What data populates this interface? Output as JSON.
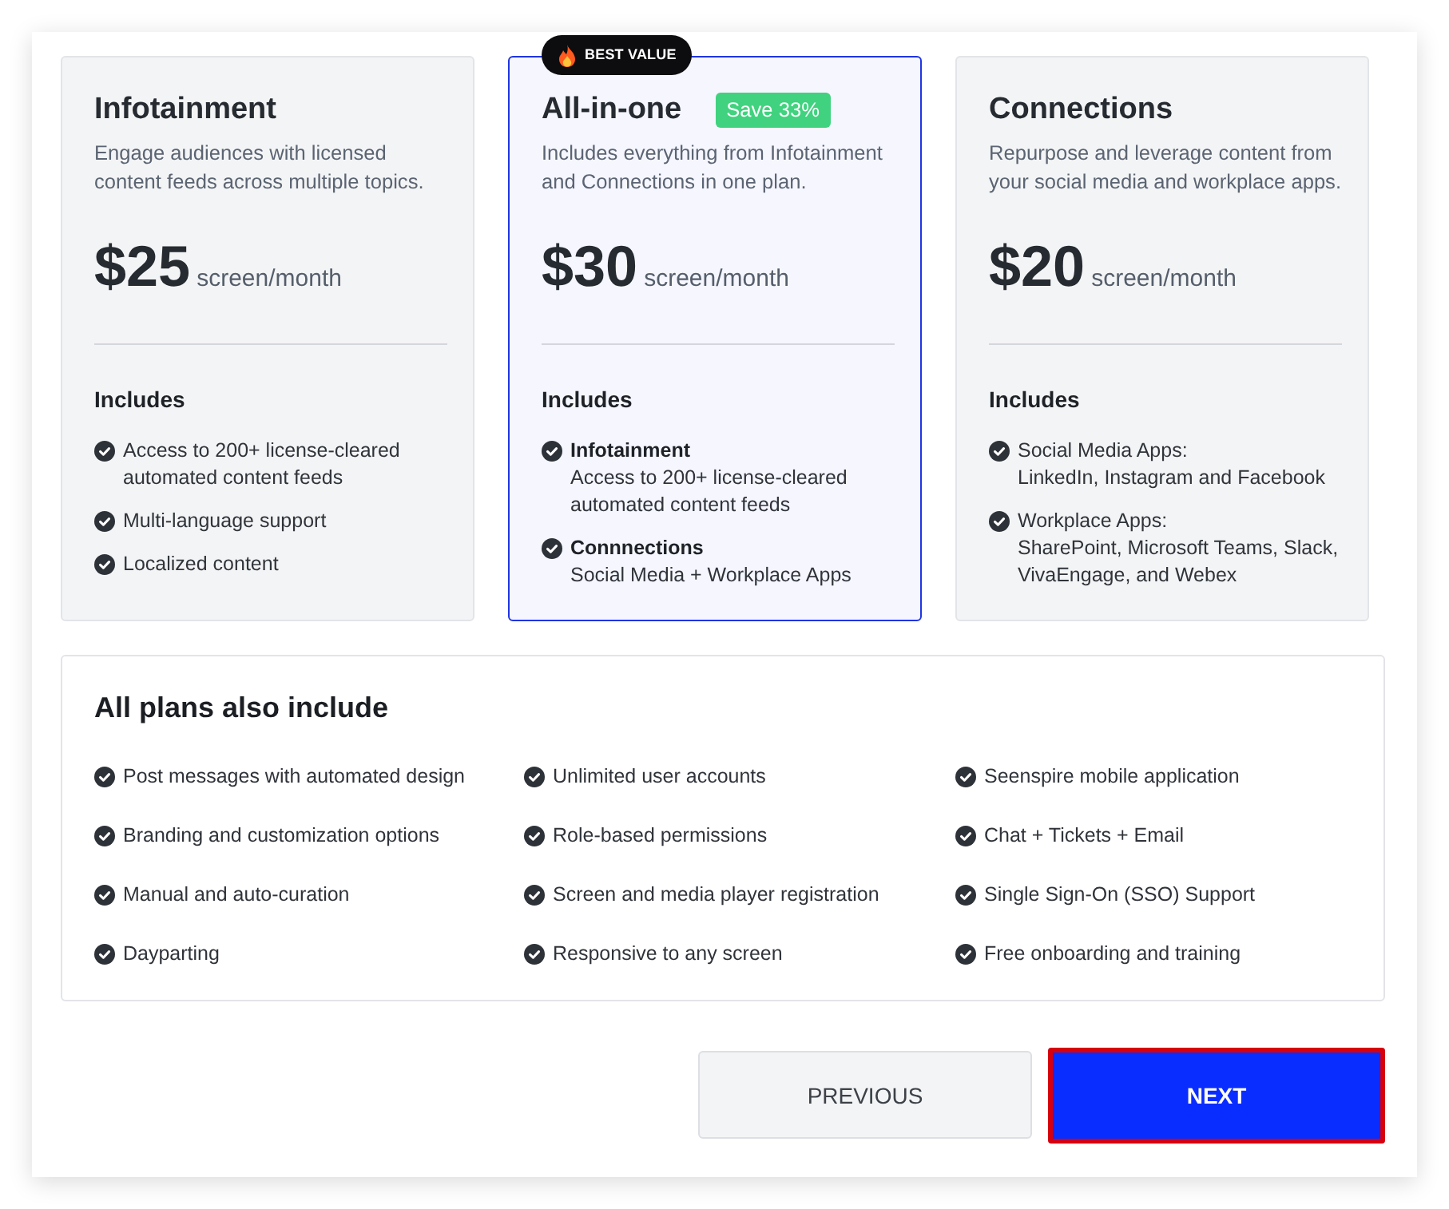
{
  "plans": [
    {
      "name": "Infotainment",
      "selected": false,
      "description": "Engage audiences with licensed content feeds across multiple topics.",
      "price": "$25",
      "unit": "screen/month",
      "includes_heading": "Includes",
      "features": [
        {
          "text": "Access to 200+ license-cleared automated content feeds"
        },
        {
          "text": "Multi-language support"
        },
        {
          "text": "Localized content"
        }
      ]
    },
    {
      "name": "All-in-one",
      "selected": true,
      "ribbon": "BEST VALUE",
      "tag": "Save 33%",
      "description": "Includes everything from Infotainment and Connections in one plan.",
      "price": "$30",
      "unit": "screen/month",
      "includes_heading": "Includes",
      "features": [
        {
          "title": "Infotainment",
          "bold": true,
          "text": "Access to 200+ license-cleared automated content feeds"
        },
        {
          "title": "Connnections",
          "bold": true,
          "text": "Social Media + Workplace Apps"
        }
      ]
    },
    {
      "name": "Connections",
      "selected": false,
      "description": "Repurpose and leverage content from your social media and workplace apps.",
      "price": "$20",
      "unit": "screen/month",
      "includes_heading": "Includes",
      "features": [
        {
          "title": "Social Media Apps:",
          "bold": false,
          "text": "LinkedIn, Instagram and Facebook"
        },
        {
          "title": "Workplace Apps:",
          "bold": false,
          "text": "SharePoint, Microsoft Teams, Slack, VivaEngage, and Webex"
        }
      ]
    }
  ],
  "all_plans": {
    "heading": "All plans also include",
    "columns": [
      [
        "Post messages with automated design",
        "Branding and customization options",
        "Manual and auto-curation",
        "Dayparting"
      ],
      [
        "Unlimited user accounts",
        "Role-based permissions",
        "Screen and media player registration",
        "Responsive to any screen"
      ],
      [
        "Seenspire mobile application",
        "Chat + Tickets + Email",
        "Single Sign-On (SSO) Support",
        "Free onboarding and training"
      ]
    ]
  },
  "buttons": [
    {
      "label": "PREVIOUS",
      "kind": "secondary",
      "focused": false
    },
    {
      "label": "NEXT",
      "kind": "primary",
      "focused": true
    }
  ]
}
